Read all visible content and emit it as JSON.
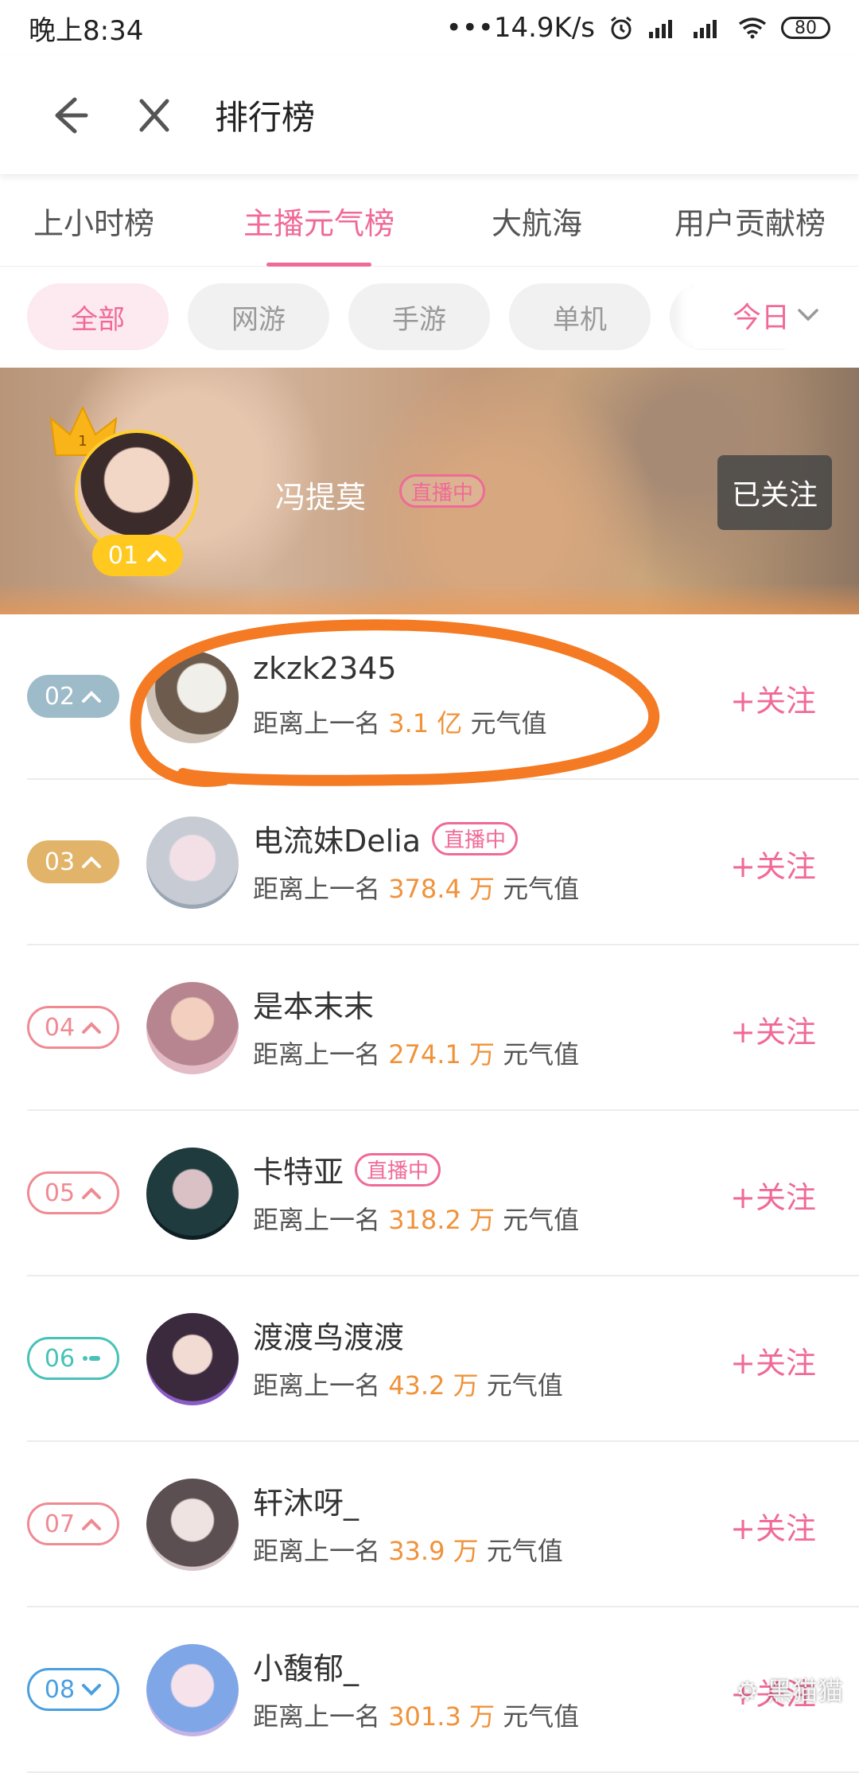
{
  "status_bar": {
    "time": "晚上8:34",
    "net_speed": "•••14.9K/s",
    "battery": "80"
  },
  "header": {
    "title": "排行榜"
  },
  "tabs": [
    {
      "label": "上小时榜"
    },
    {
      "label": "主播元气榜",
      "active": true
    },
    {
      "label": "大航海"
    },
    {
      "label": "用户贡献榜"
    }
  ],
  "filters": {
    "chips": [
      "全部",
      "网游",
      "手游",
      "单机"
    ],
    "date_label": "今日"
  },
  "top1": {
    "rank": "01",
    "name": "冯提莫",
    "live_label": "直播中",
    "follow_label": "已关注"
  },
  "list": [
    {
      "rank": "02",
      "trend": "up",
      "name": "zkzk2345",
      "live": false,
      "gap_prefix": "距离上一名",
      "gap_value": "3.1 亿",
      "gap_suffix": "元气值",
      "follow_label": "+关注",
      "rank_color": "#9dbbc9",
      "rank_style": "filled"
    },
    {
      "rank": "03",
      "trend": "up",
      "name": "电流妹Delia",
      "live": true,
      "live_label": "直播中",
      "gap_prefix": "距离上一名",
      "gap_value": "378.4 万",
      "gap_suffix": "元气值",
      "follow_label": "+关注",
      "rank_color": "#e2b469",
      "rank_style": "filled"
    },
    {
      "rank": "04",
      "trend": "up",
      "name": "是本末末",
      "live": false,
      "gap_prefix": "距离上一名",
      "gap_value": "274.1 万",
      "gap_suffix": "元气值",
      "follow_label": "+关注",
      "rank_color": "#ef8a93",
      "rank_style": "outline"
    },
    {
      "rank": "05",
      "trend": "up",
      "name": "卡特亚",
      "live": true,
      "live_label": "直播中",
      "gap_prefix": "距离上一名",
      "gap_value": "318.2 万",
      "gap_suffix": "元气值",
      "follow_label": "+关注",
      "rank_color": "#ef8a93",
      "rank_style": "outline"
    },
    {
      "rank": "06",
      "trend": "same",
      "name": "渡渡鸟渡渡",
      "live": false,
      "gap_prefix": "距离上一名",
      "gap_value": "43.2 万",
      "gap_suffix": "元气值",
      "follow_label": "+关注",
      "rank_color": "#47c2b7",
      "rank_style": "outline"
    },
    {
      "rank": "07",
      "trend": "up",
      "name": "轩沐呀_",
      "live": false,
      "gap_prefix": "距离上一名",
      "gap_value": "33.9 万",
      "gap_suffix": "元气值",
      "follow_label": "+关注",
      "rank_color": "#ef8a93",
      "rank_style": "outline"
    },
    {
      "rank": "08",
      "trend": "down",
      "name": "小馥郁_",
      "live": false,
      "gap_prefix": "距离上一名",
      "gap_value": "301.3 万",
      "gap_suffix": "元气值",
      "follow_label": "+关注",
      "rank_color": "#4a9fe0",
      "rank_style": "outline"
    }
  ],
  "watermark": "⚙ 黑猫猫"
}
